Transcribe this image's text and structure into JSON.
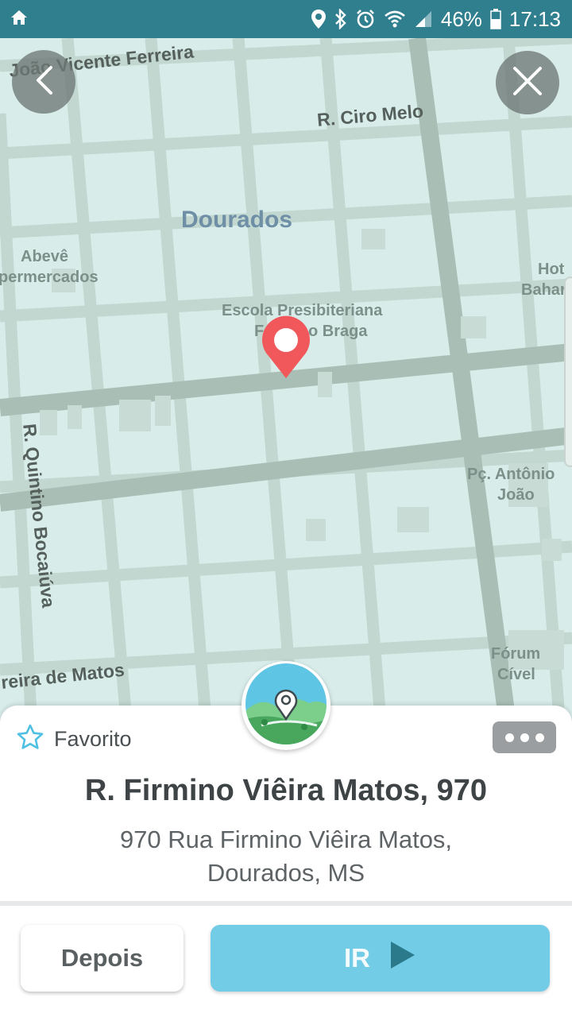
{
  "status_bar": {
    "battery": "46%",
    "time": "17:13",
    "icons": [
      "home-icon",
      "location-icon",
      "bluetooth-icon",
      "alarm-icon",
      "wifi-icon",
      "signal-icon",
      "battery-icon"
    ]
  },
  "map": {
    "labels": {
      "street_joao": "João Vicente Ferreira",
      "street_ciro": "R. Ciro Melo",
      "city": "Dourados",
      "poi_abeve_1": "Abevê",
      "poi_abeve_2": "permercados",
      "poi_school_1": "Escola Presibiteriana",
      "poi_school_2": "F",
      "poi_school_3": "o Braga",
      "poi_hotel_1": "Hot",
      "poi_hotel_2": "Bahar",
      "street_quintino": "R. Quintino Bocaiúva",
      "poi_praca_1": "Pç. Antônio",
      "poi_praca_2": "João",
      "street_matos": "reira de Matos",
      "poi_forum_1": "Fórum",
      "poi_forum_2": "Cível"
    },
    "colors": {
      "land": "#d8ece9",
      "road": "#b9cdc5",
      "pin": "#f0585b"
    }
  },
  "card": {
    "favorite_label": "Favorito",
    "title": "R. Firmino Viêira Matos, 970",
    "subtitle_line1": "970 Rua Firmino Viêira Matos,",
    "subtitle_line2": "Dourados, MS"
  },
  "actions": {
    "later_label": "Depois",
    "go_label": "IR"
  },
  "colors": {
    "status_bar": "#2f7f8f",
    "go_button": "#73cce6",
    "go_arrow": "#2a7a8c"
  }
}
